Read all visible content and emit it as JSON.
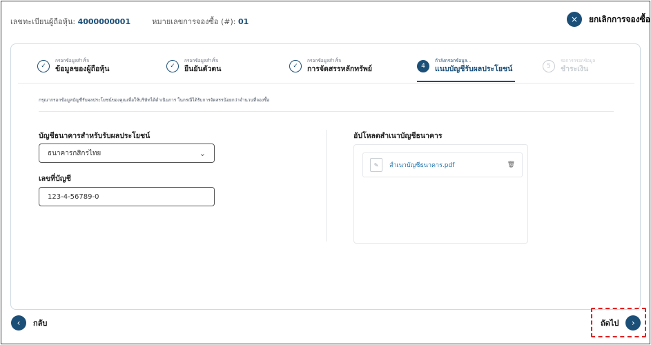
{
  "header": {
    "shareholder_label": "เลขทะเบียนผู้ถือหุ้น:",
    "shareholder_value": "4000000001",
    "booking_label": "หมายเลขการจองซื้อ (#):",
    "booking_value": "01",
    "cancel_icon": "×",
    "cancel_label": "ยกเลิกการจองซื้อ"
  },
  "steps": [
    {
      "small": "กรอกข้อมูลสำเร็จ",
      "title": "ข้อมูลของผู้ถือหุ้น",
      "icon": "✓",
      "state": "done"
    },
    {
      "small": "กรอกข้อมูลสำเร็จ",
      "title": "ยืนยันตัวตน",
      "icon": "✓",
      "state": "done"
    },
    {
      "small": "กรอกข้อมูลสำเร็จ",
      "title": "การจัดสรรหลักทรัพย์",
      "icon": "✓",
      "state": "done"
    },
    {
      "small": "กำลังกรอกข้อมูล...",
      "title": "แนบบัญชีรับผลประโยชน์",
      "icon": "4",
      "state": "active"
    },
    {
      "small": "รอการกรอกข้อมูล",
      "title": "ชำระเงิน",
      "icon": "5",
      "state": "pending"
    }
  ],
  "instruction": "กรุณากรอกข้อมูลบัญชีรับผลประโยชน์ของคุณเพื่อให้บริษัทได้ดำเนินการ ในกรณีได้รับการจัดสรรน้อยกว่าจำนวนที่จองซื้อ",
  "form": {
    "bank_label": "บัญชีธนาคารสำหรับรับผลประโยชน์",
    "bank_value": "ธนาคารกสิกรไทย",
    "account_label": "เลขที่บัญชี",
    "account_value": "123-4-56789-0",
    "upload_label": "อัปโหลดสำเนาบัญชีธนาคาร",
    "file_name": "สำเนาบัญชีธนาคาร.pdf"
  },
  "footer": {
    "back_icon": "‹",
    "back_label": "กลับ",
    "next_label": "ถัดไป",
    "next_icon": "›"
  },
  "colors": {
    "primary": "#1b4f78",
    "highlight": "#e02020"
  },
  "icons": [
    "close-icon",
    "check-circle-icon",
    "chevron-down-icon",
    "file-icon",
    "trash-icon",
    "chevron-left-icon",
    "chevron-right-icon"
  ]
}
